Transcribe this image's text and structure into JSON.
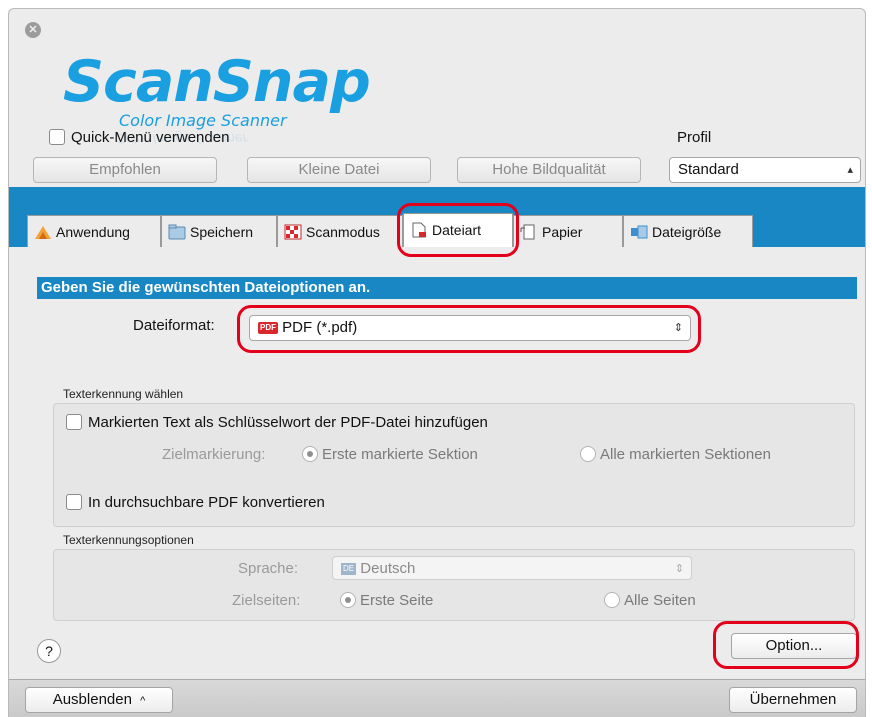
{
  "app": {
    "logo_main": "ScanSnap",
    "logo_sub": "Color Image Scanner",
    "logo_reflection": "Color Image Scanner",
    "brand_color": "#1a9fe0",
    "accent_color": "#1887c4",
    "highlight_color": "#e3001b"
  },
  "header": {
    "quick_menu_label": "Quick-Menü verwenden",
    "quick_menu_checked": false,
    "profile_label": "Profil",
    "profile_value": "Standard",
    "presets": [
      "Empfohlen",
      "Kleine Datei",
      "Hohe Bildqualität"
    ]
  },
  "tabs": [
    {
      "label": "Anwendung",
      "icon": "application-icon",
      "active": false
    },
    {
      "label": "Speichern",
      "icon": "folder-icon",
      "active": false
    },
    {
      "label": "Scanmodus",
      "icon": "scan-mode-icon",
      "active": false
    },
    {
      "label": "Dateiart",
      "icon": "file-type-icon",
      "active": true
    },
    {
      "label": "Papier",
      "icon": "paper-icon",
      "active": false
    },
    {
      "label": "Dateigröße",
      "icon": "file-size-icon",
      "active": false
    }
  ],
  "main": {
    "heading": "Geben Sie die gewünschten Dateioptionen an.",
    "file_format_label": "Dateiformat:",
    "file_format_value": "PDF (*.pdf)",
    "file_format_badge": "PDF",
    "ocr_section": {
      "title": "Texterkennung wählen",
      "keyword_checkbox": "Markierten Text als Schlüsselwort der PDF-Datei hinzufügen",
      "target_label": "Zielmarkierung:",
      "target_options": [
        "Erste markierte Sektion",
        "Alle markierten Sektionen"
      ],
      "searchable_checkbox": "In durchsuchbare PDF konvertieren"
    },
    "ocr_options": {
      "title": "Texterkennungsoptionen",
      "language_label": "Sprache:",
      "language_value": "Deutsch",
      "language_badge": "DE",
      "pages_label": "Zielseiten:",
      "pages_options": [
        "Erste Seite",
        "Alle Seiten"
      ]
    },
    "help_label": "?",
    "option_button": "Option..."
  },
  "footer": {
    "hide_button": "Ausblenden",
    "apply_button": "Übernehmen"
  }
}
